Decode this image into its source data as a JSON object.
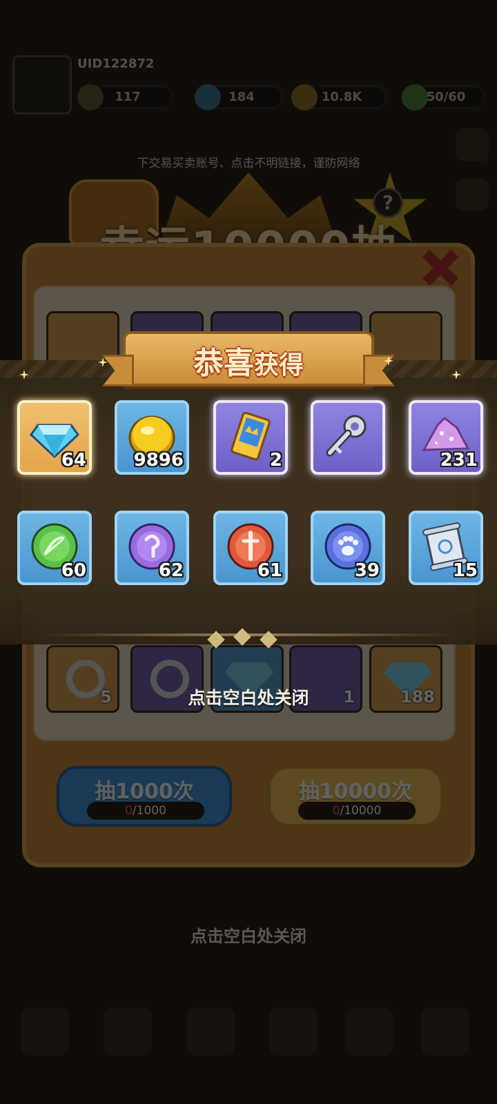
{
  "background": {
    "uid_text": "UID122872",
    "resources": [
      {
        "name": "power",
        "value": "117"
      },
      {
        "name": "gems",
        "value": "184"
      },
      {
        "name": "coins",
        "value": "10.8K"
      },
      {
        "name": "energy",
        "value": "50/60"
      }
    ],
    "notice": "下交易买卖账号、点击不明链接，谨防网络",
    "banner_title": "幸运10000抽",
    "help_label": "?",
    "bottom_row_counts": [
      "5",
      "1",
      "188"
    ],
    "draw_1000": {
      "label": "抽1000次",
      "progress_current": "0",
      "progress_total": "/1000"
    },
    "draw_10000": {
      "label": "抽10000次",
      "progress_current": "0",
      "progress_total": "/10000"
    },
    "footer_hint": "点击空白处关闭"
  },
  "reward": {
    "title_part1": "恭喜",
    "title_part2": "获得",
    "items": [
      {
        "name": "diamond",
        "count": "64",
        "rarity": "gold",
        "color": "#5fd0f2"
      },
      {
        "name": "gold-coin",
        "count": "9896",
        "rarity": "blue",
        "color": "#f2c21a"
      },
      {
        "name": "ticket",
        "count": "2",
        "rarity": "purple",
        "color": "#f0c040"
      },
      {
        "name": "silver-key",
        "count": "",
        "rarity": "purple",
        "color": "#d8dde4"
      },
      {
        "name": "purple-dust",
        "count": "231",
        "rarity": "purple",
        "color": "#d49ae8"
      },
      {
        "name": "green-bow-orb",
        "count": "60",
        "rarity": "blue",
        "color": "#5ac04a"
      },
      {
        "name": "purple-hook-orb",
        "count": "62",
        "rarity": "blue",
        "color": "#9a6ae0"
      },
      {
        "name": "red-sword-orb",
        "count": "61",
        "rarity": "blue",
        "color": "#e0583a"
      },
      {
        "name": "blue-paw-orb",
        "count": "39",
        "rarity": "blue",
        "color": "#5a70e0"
      },
      {
        "name": "scroll",
        "count": "15",
        "rarity": "blue",
        "color": "#dfe8f0"
      }
    ],
    "close_hint": "点击空白处关闭"
  }
}
